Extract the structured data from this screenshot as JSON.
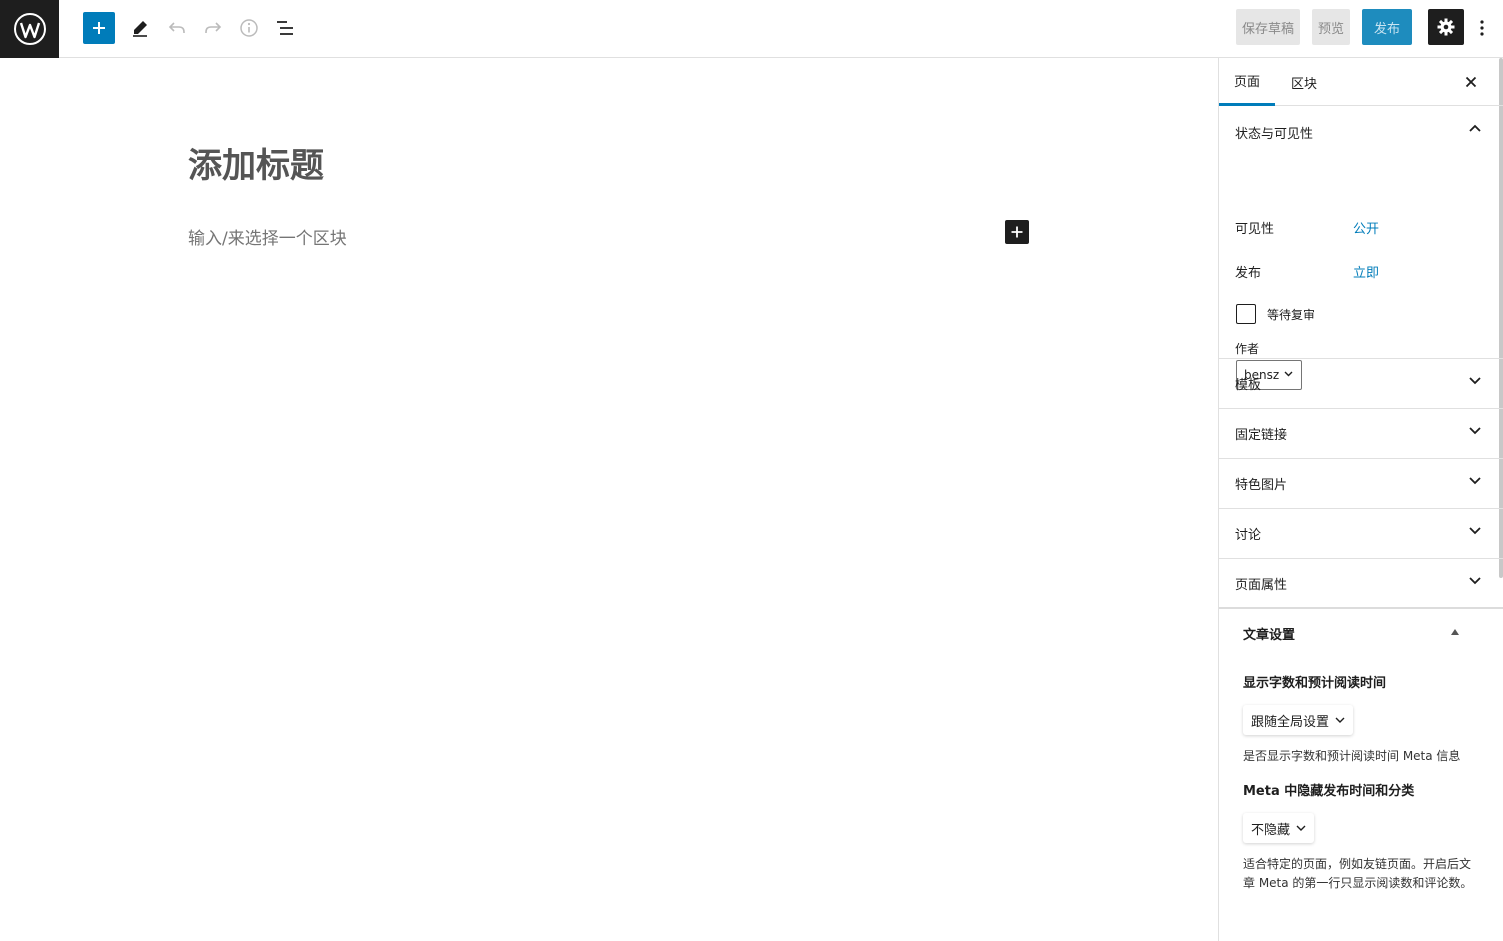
{
  "toolbar": {
    "save_draft": "保存草稿",
    "preview": "预览",
    "publish": "发布"
  },
  "editor": {
    "title_placeholder": "添加标题",
    "block_placeholder": "输入/来选择一个区块"
  },
  "sidebar": {
    "tabs": [
      {
        "label": "页面"
      },
      {
        "label": "区块"
      }
    ],
    "status": {
      "title": "状态与可见性",
      "visibility_label": "可见性",
      "visibility_value": "公开",
      "publish_label": "发布",
      "publish_value": "立即",
      "pending_review": "等待复审",
      "author_label": "作者",
      "author_value": "bensz"
    },
    "panels": [
      {
        "label": "模板"
      },
      {
        "label": "固定链接"
      },
      {
        "label": "特色图片"
      },
      {
        "label": "讨论"
      },
      {
        "label": "页面属性"
      }
    ],
    "custom": {
      "title": "文章设置",
      "opt1_title": "显示字数和预计阅读时间",
      "opt1_value": "跟随全局设置",
      "opt1_desc": "是否显示字数和预计阅读时间 Meta 信息",
      "opt2_title": "Meta 中隐藏发布时间和分类",
      "opt2_value": "不隐藏",
      "opt2_desc": "适合特定的页面，例如友链页面。开启后文章 Meta 的第一行只显示阅读数和评论数。"
    }
  },
  "colors": {
    "accent": "#007cba",
    "dark": "#1e1e1e",
    "publish_bg": "#1e8cbe"
  },
  "icons": [
    "wordpress-logo-icon",
    "plus-icon",
    "pencil-icon",
    "undo-icon",
    "redo-icon",
    "info-icon",
    "list-view-icon",
    "gear-icon",
    "more-vertical-icon",
    "close-icon",
    "chevron-up-icon",
    "chevron-down-icon"
  ]
}
